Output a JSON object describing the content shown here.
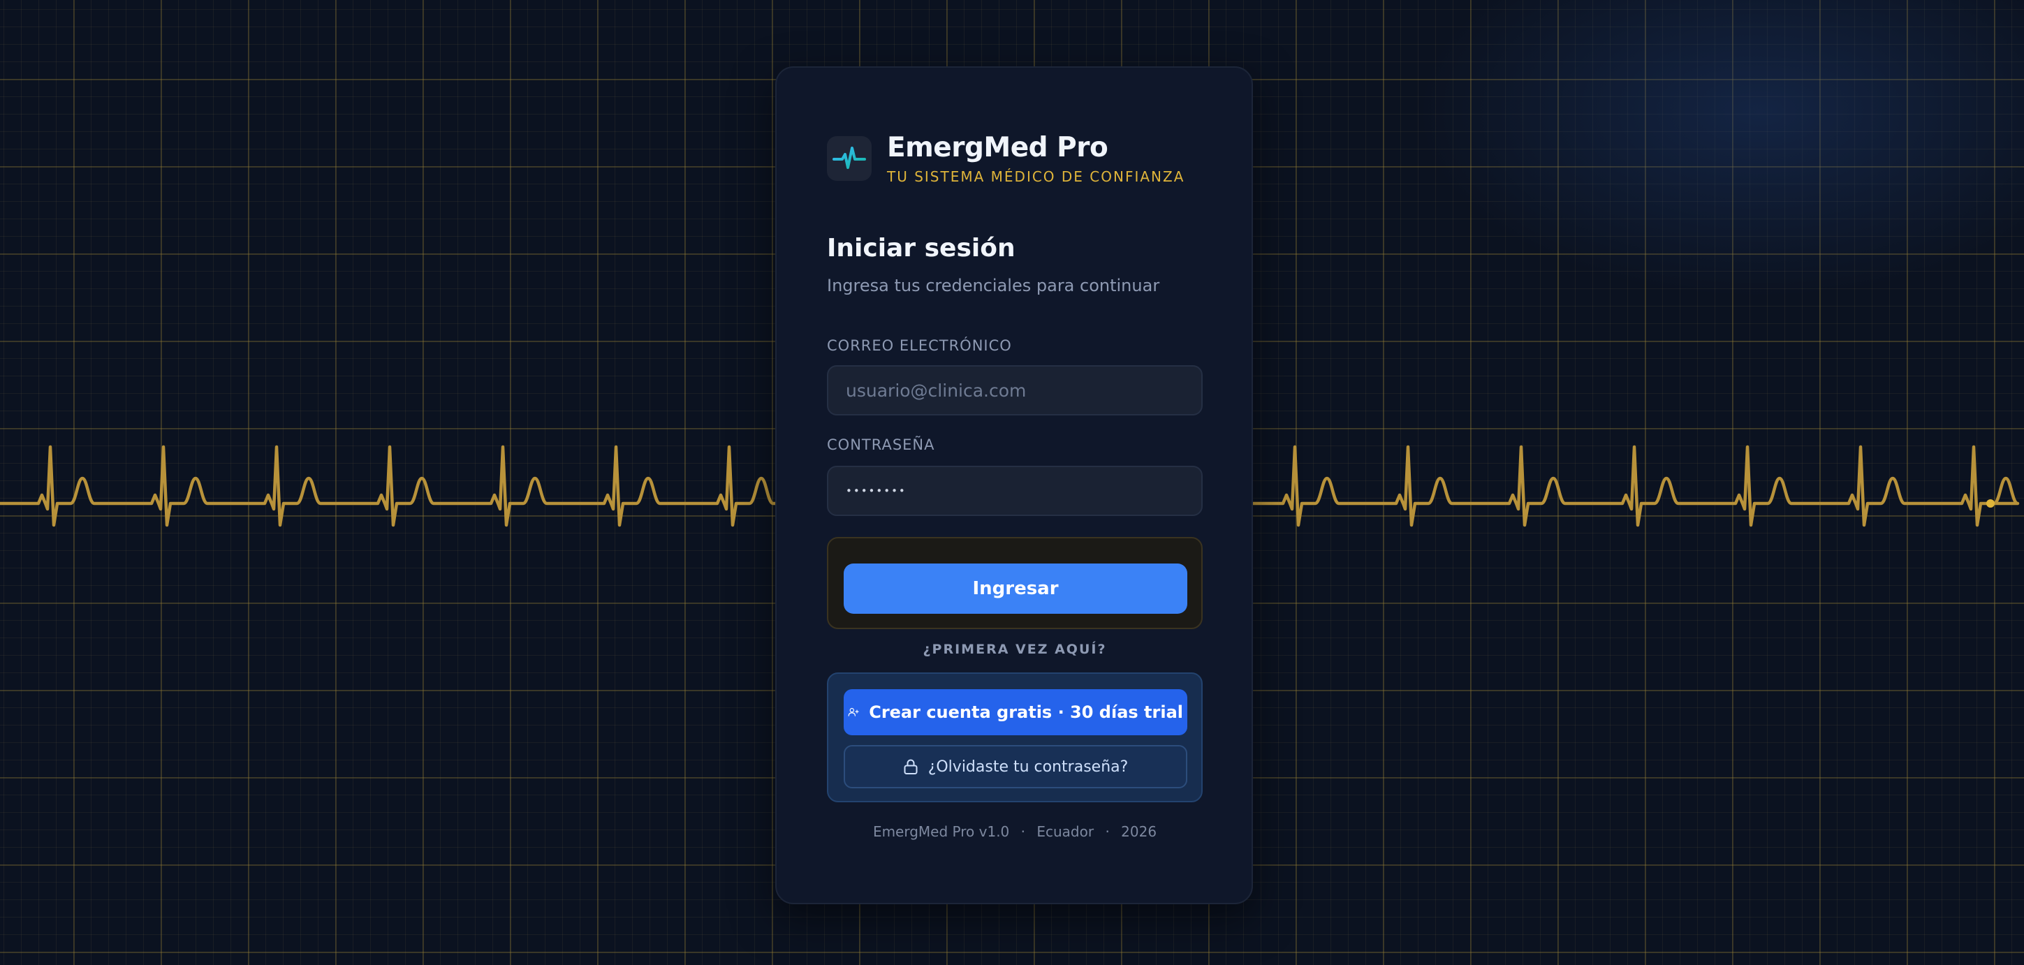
{
  "brand": {
    "name": "EmergMed Pro",
    "tagline": "TU SISTEMA MÉDICO DE CONFIANZA"
  },
  "login": {
    "title": "Iniciar sesión",
    "subtitle": "Ingresa tus credenciales para continuar",
    "email_label": "CORREO ELECTRÓNICO",
    "email_placeholder": "usuario@clinica.com",
    "email_value": "",
    "password_label": "CONTRASEÑA",
    "password_value": "••••••••",
    "submit_label": "Ingresar"
  },
  "signup": {
    "prompt": "¿PRIMERA VEZ AQUÍ?",
    "create_label": "Crear cuenta gratis · 30 días trial",
    "forgot_label": "¿Olvidaste tu contraseña?"
  },
  "footer": {
    "version": "EmergMed Pro v1.0",
    "country": "Ecuador",
    "year": "2026",
    "separator": "·"
  },
  "icons": {
    "logo": "pulse-icon",
    "create": "user-plus-icon",
    "forgot": "lock-icon"
  },
  "colors": {
    "background": "#0b1220",
    "card": "#0f172a",
    "accent_gold": "#e0b53a",
    "primary_blue": "#3b82f6",
    "create_blue": "#2563eb",
    "ecg_trace": "#b8923a"
  }
}
